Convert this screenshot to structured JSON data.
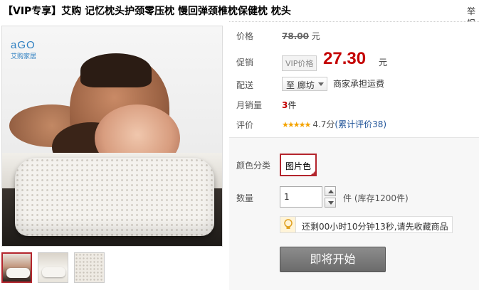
{
  "product": {
    "title": "【VIP专享】艾购 记忆枕头护颈零压枕 慢回弹颈椎枕保健枕 枕头",
    "report": "举报"
  },
  "gallery": {
    "logo_text": "aGO",
    "logo_sub": "艾购家居"
  },
  "price": {
    "label": "价格",
    "original": "78.00",
    "currency": "元"
  },
  "promo": {
    "label": "促销",
    "tag": "VIP价格",
    "price": "27.30",
    "currency": "元"
  },
  "shipping": {
    "label": "配送",
    "location": "至 廊坊",
    "note": "商家承担运费"
  },
  "sales": {
    "label": "月销量",
    "count": "3",
    "unit": "件"
  },
  "rating": {
    "label": "评价",
    "stars": "★★★★★",
    "score": "4.7分",
    "reviews_link": "(累计评价38)"
  },
  "options": {
    "color_label": "颜色分类",
    "color_value": "图片色",
    "qty_label": "数量",
    "qty_value": "1",
    "stock_text": "件 (库存1200件)",
    "countdown_text": "还剩00小时10分钟13秒,请先收藏商品",
    "start_button": "即将开始"
  },
  "colors": {
    "price_red": "#c40000",
    "selected_border": "#b4252d",
    "link_blue": "#225599",
    "star": "#f4a300"
  }
}
